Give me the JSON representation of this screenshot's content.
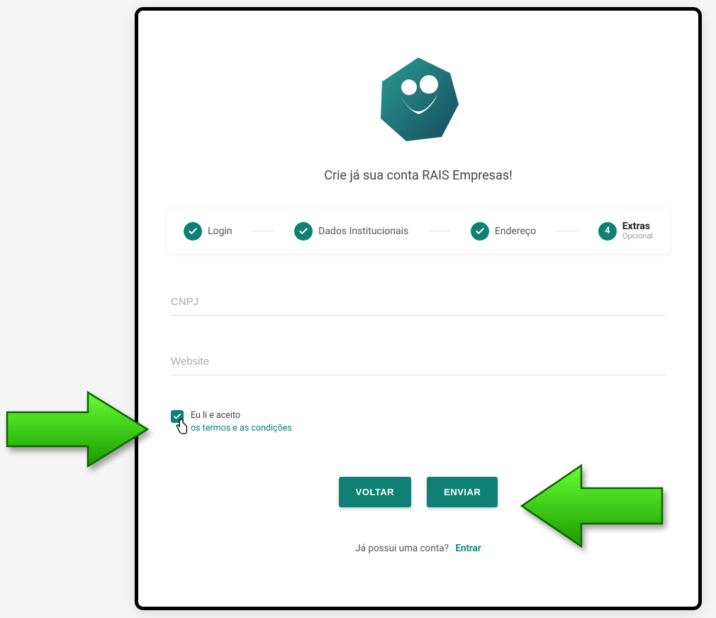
{
  "heading": "Crie já sua conta RAIS Empresas!",
  "stepper": {
    "steps": [
      {
        "label": "Login",
        "completed": true
      },
      {
        "label": "Dados Institucionais",
        "completed": true
      },
      {
        "label": "Endereço",
        "completed": true
      },
      {
        "number": "4",
        "label": "Extras",
        "sublabel": "Opcional",
        "active": true
      }
    ]
  },
  "form": {
    "cnpj": {
      "placeholder": "CNPJ",
      "value": ""
    },
    "website": {
      "placeholder": "Website",
      "value": ""
    }
  },
  "terms": {
    "checked": true,
    "text_prefix": "Eu li e aceito",
    "link_text": "os termos e as condições"
  },
  "buttons": {
    "back": "VOLTAR",
    "submit": "ENVIAR"
  },
  "footer": {
    "question": "Já possui uma conta?",
    "link": "Entrar"
  },
  "colors": {
    "primary": "#0e8174",
    "arrow": "#33cc00"
  }
}
